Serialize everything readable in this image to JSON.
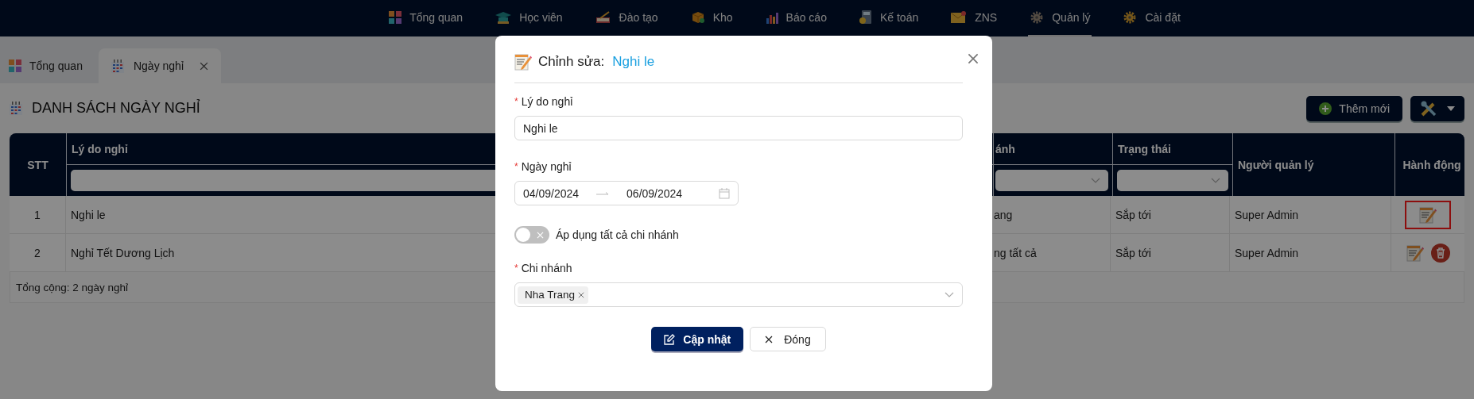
{
  "nav": {
    "items": [
      {
        "label": "Tổng quan",
        "kind": "dashboard",
        "selected": false
      },
      {
        "label": "Học viên",
        "kind": "student",
        "selected": false
      },
      {
        "label": "Đào tạo",
        "kind": "training",
        "selected": false
      },
      {
        "label": "Kho",
        "kind": "warehouse",
        "selected": false
      },
      {
        "label": "Báo cáo",
        "kind": "report",
        "selected": false
      },
      {
        "label": "Kế toán",
        "kind": "accounting",
        "selected": false
      },
      {
        "label": "ZNS",
        "kind": "zns",
        "selected": false
      },
      {
        "label": "Quản lý",
        "kind": "manage",
        "selected": true
      },
      {
        "label": "Cài đặt",
        "kind": "settings",
        "selected": false
      }
    ]
  },
  "tabs": [
    {
      "label": "Tổng quan",
      "kind": "dashboard",
      "selected": false,
      "closable": false
    },
    {
      "label": "Ngày nghỉ",
      "kind": "calendar",
      "selected": true,
      "closable": true
    }
  ],
  "page": {
    "title": "DANH SÁCH NGÀY NGHỈ",
    "add_button": "Thêm mới"
  },
  "table": {
    "columns": [
      {
        "label": "STT",
        "kind": "plain"
      },
      {
        "label": "Lý do nghỉ",
        "kind": "text-filter"
      },
      {
        "label": "ánh",
        "kind": "select-filter"
      },
      {
        "label": "Trạng thái",
        "kind": "select-filter"
      },
      {
        "label": "Người quản lý",
        "kind": "plain"
      },
      {
        "label": "Hành động",
        "kind": "plain"
      }
    ],
    "rows": [
      {
        "cells": [
          "1",
          "Nghi le",
          "ang",
          "Sắp tới",
          "Super Admin"
        ],
        "actions": [
          {
            "kind": "edit",
            "highlighted": true
          }
        ]
      },
      {
        "cells": [
          "2",
          "Nghỉ Tết Dương Lịch",
          "ng tất cả",
          "Sắp tới",
          "Super Admin"
        ],
        "actions": [
          {
            "kind": "edit",
            "highlighted": false
          },
          {
            "kind": "delete",
            "highlighted": false
          }
        ]
      }
    ],
    "footer": "Tổng cộng: 2 ngày nghỉ"
  },
  "modal": {
    "title": "Chỉnh sửa:",
    "subject": "Nghi le",
    "fields": [
      {
        "kind": "text",
        "required_mark": "*",
        "label": "Lý do nghỉ",
        "value": "Nghi le"
      },
      {
        "kind": "date-range",
        "required_mark": "*",
        "label": "Ngày nghỉ",
        "start": "04/09/2024",
        "end": "06/09/2024"
      },
      {
        "kind": "switch",
        "label": "Áp dụng tất cả chi nhánh",
        "on": false
      },
      {
        "kind": "tags",
        "required_mark": "*",
        "label": "Chi nhánh",
        "tags": [
          "Nha Trang"
        ]
      }
    ],
    "buttons": [
      {
        "label": "Cập nhật",
        "kind": "primary"
      },
      {
        "label": "Đóng",
        "kind": "close"
      }
    ]
  }
}
